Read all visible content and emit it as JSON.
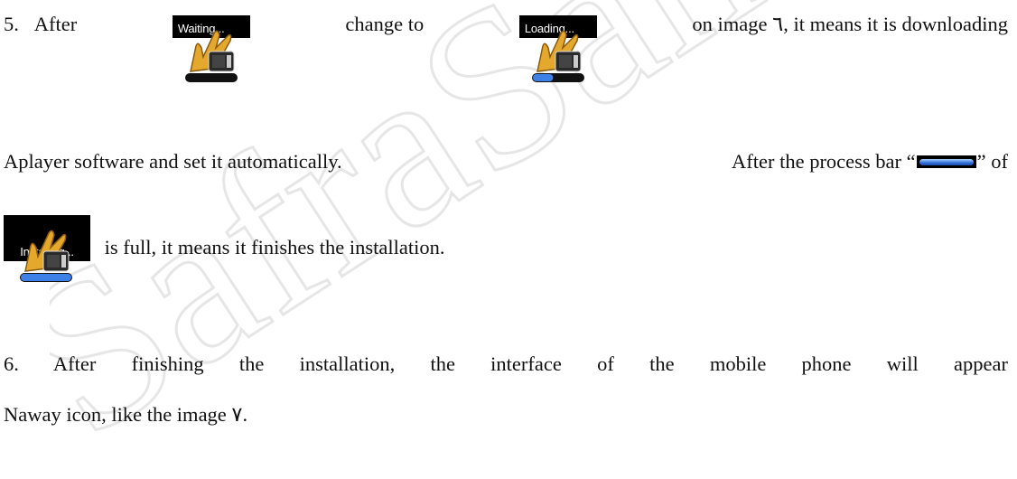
{
  "item5": {
    "number": "5.",
    "after": "After",
    "change_to": "change to",
    "on_image": "on image",
    "image_ref": "٦",
    "rest": ", it means it is downloading",
    "line2_a": "Aplayer software and set it automatically.",
    "line2_b": "After the process bar “",
    "line2_c": "” of",
    "line3": "is full, it means it finishes the installation."
  },
  "icons": {
    "waiting": {
      "label": "Waiting...",
      "progress": 0
    },
    "loading": {
      "label": "Loading...",
      "progress": 0.4
    },
    "installing": {
      "label": "Installing...",
      "progress": 1
    }
  },
  "item6": {
    "line1": "6. After finishing the installation, the interface of the mobile phone will appear",
    "line2": "Naway icon, like the image ٧."
  },
  "watermark": "SafraSanad"
}
